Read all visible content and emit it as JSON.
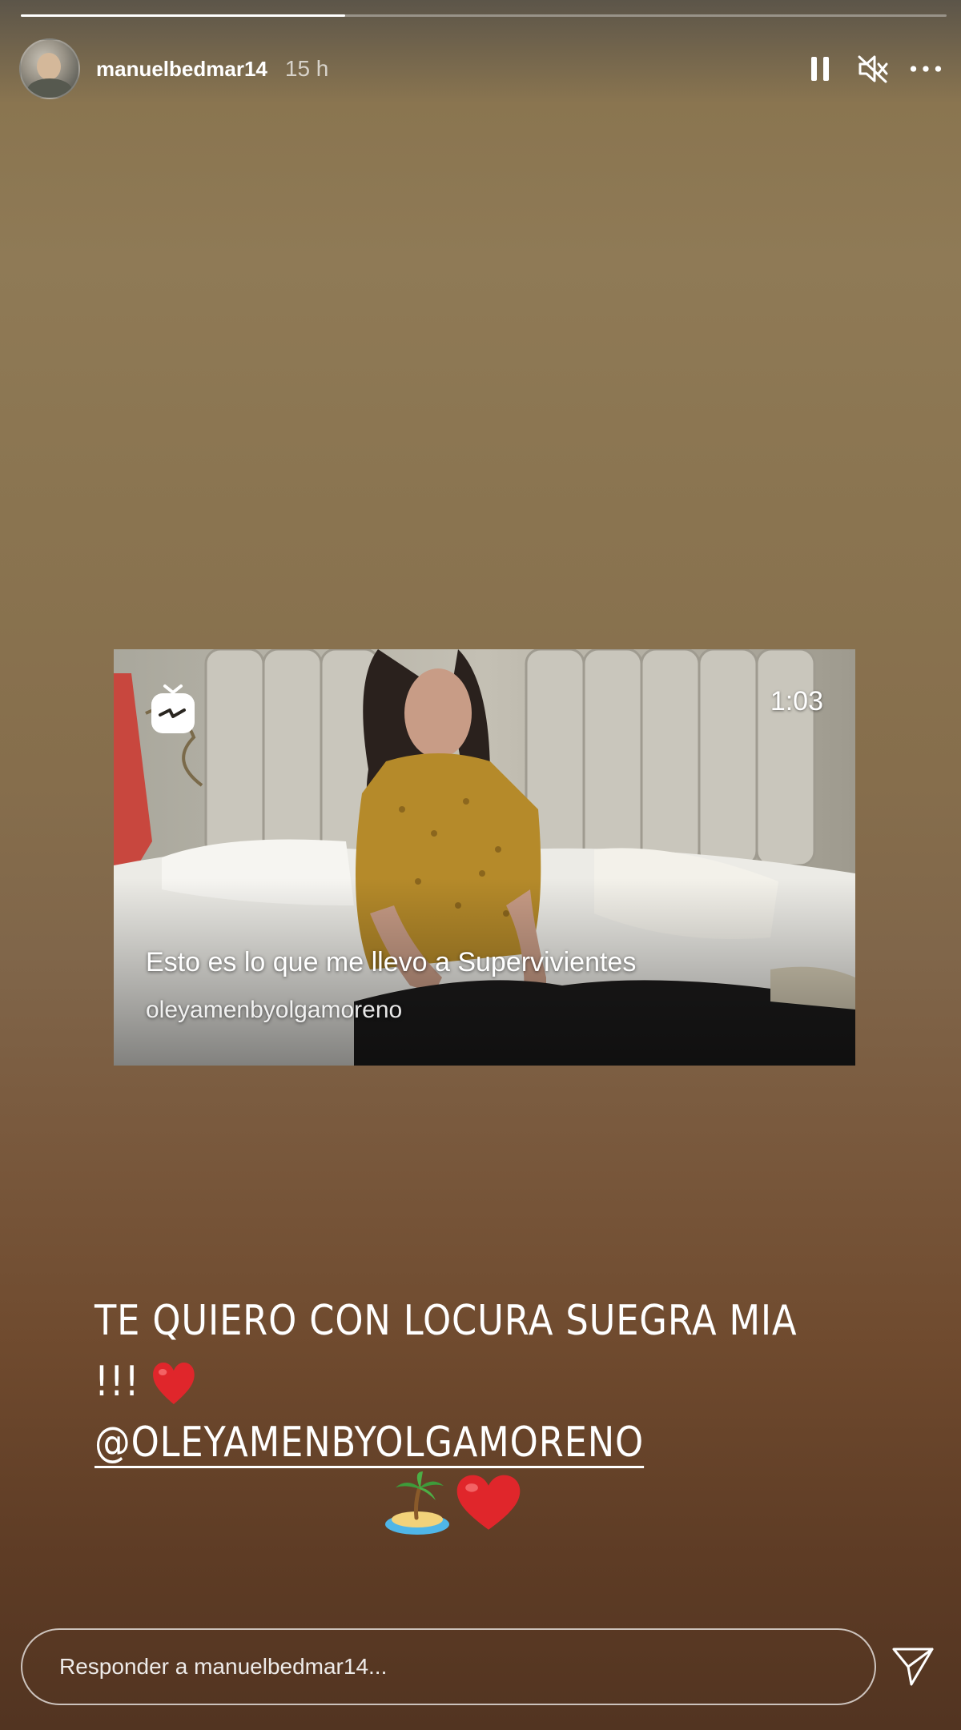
{
  "story": {
    "progress_fraction": 0.35,
    "username": "manuelbedmar14",
    "time": "15 h",
    "icons": {
      "pause": "pause-icon",
      "mute": "speaker-muted-icon",
      "more": "more-options-icon"
    }
  },
  "media": {
    "icon": "igtv-icon",
    "duration": "1:03",
    "caption": "Esto es lo que me llevo a Supervivientes",
    "account": "oleyamenbyolgamoreno"
  },
  "sticker": {
    "line1": "TE QUIERO CON LOCURA SUEGRA MIA !!!",
    "mention": "@OLEYAMENBYOLGAMORENO",
    "line1_emoji": "heart-emoji",
    "emojis": [
      "desert-island-emoji",
      "heart-emoji"
    ]
  },
  "reply": {
    "placeholder": "Responder a manuelbedmar14...",
    "send_icon": "send-icon"
  },
  "colors": {
    "heart": "#e0262b",
    "text": "#ffffff"
  }
}
